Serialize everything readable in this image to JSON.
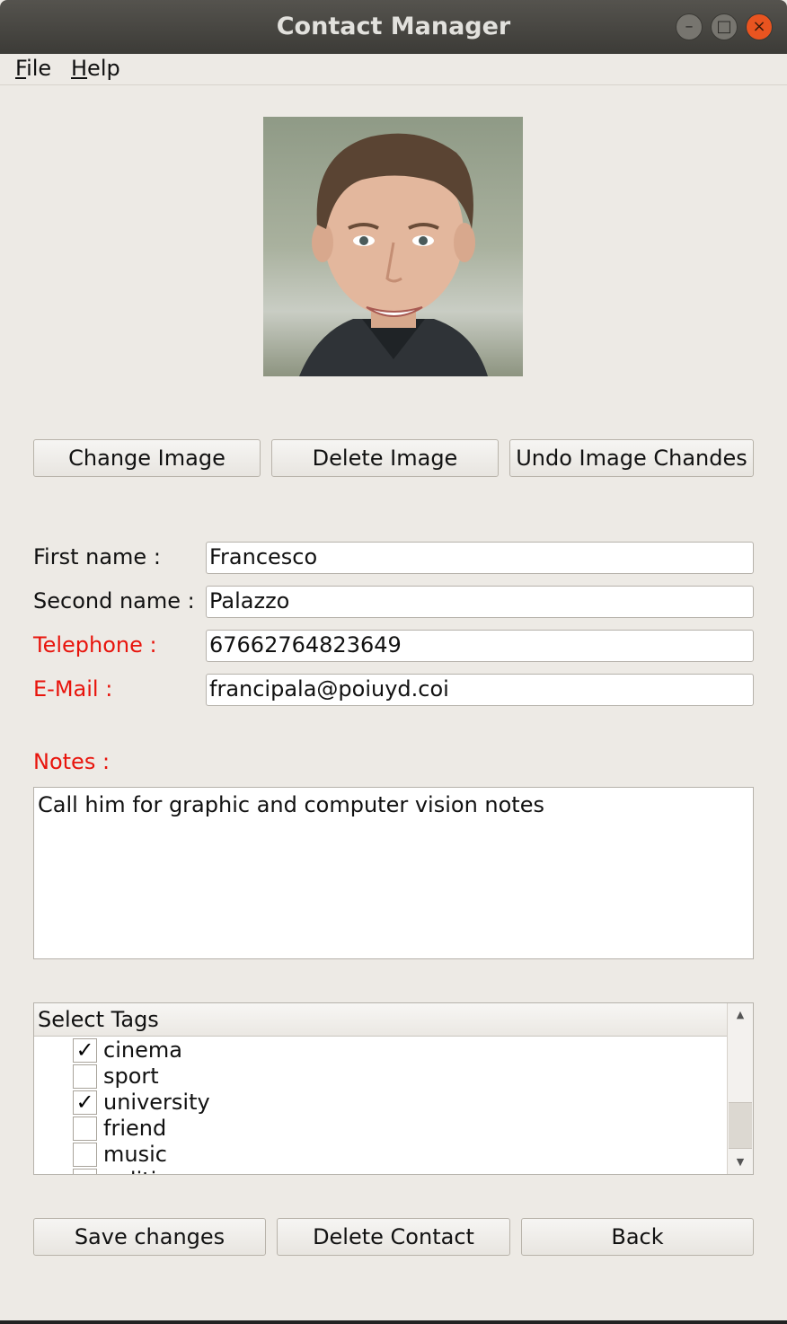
{
  "window": {
    "title": "Contact Manager",
    "controls": {
      "minimize": "–",
      "maximize": "□",
      "close": "×"
    }
  },
  "menubar": {
    "items": [
      {
        "mnemonic": "F",
        "rest": "ile"
      },
      {
        "mnemonic": "H",
        "rest": "elp"
      }
    ]
  },
  "image_buttons": {
    "change": "Change Image",
    "delete": "Delete Image",
    "undo": "Undo Image Chandes"
  },
  "form": {
    "first_name": {
      "label": "First name :",
      "value": "Francesco"
    },
    "second_name": {
      "label": "Second name :",
      "value": "Palazzo"
    },
    "telephone": {
      "label": "Telephone :",
      "value": "67662764823649"
    },
    "email": {
      "label": "E-Mail :",
      "value": "francipala@poiuyd.coi"
    },
    "notes": {
      "label": "Notes :",
      "value": "Call him for graphic and computer vision notes"
    }
  },
  "tags": {
    "header": "Select Tags",
    "items": [
      {
        "label": "cinema",
        "mark": "✓"
      },
      {
        "label": "sport",
        "mark": ""
      },
      {
        "label": "university",
        "mark": "✓"
      },
      {
        "label": "friend",
        "mark": ""
      },
      {
        "label": "music",
        "mark": ""
      },
      {
        "label": "politi",
        "mark": ""
      }
    ]
  },
  "actions": {
    "save": "Save changes",
    "delete": "Delete Contact",
    "back": "Back"
  },
  "colors": {
    "required_label": "#e8140c",
    "window_bg": "#edeae5",
    "close_button": "#e95420"
  },
  "icons": {
    "minimize": "minimize-icon",
    "maximize": "maximize-icon",
    "close": "close-icon",
    "scroll_up": "scroll-up-arrow-icon",
    "scroll_down": "scroll-down-arrow-icon",
    "check": "checkmark-icon"
  }
}
